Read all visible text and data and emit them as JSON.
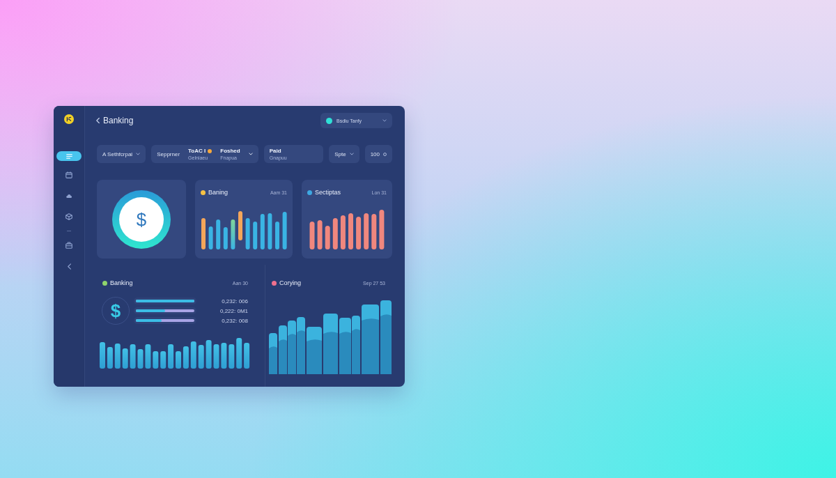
{
  "sidebar": {
    "items": [
      {
        "selected": true
      },
      {
        "selected": false
      },
      {
        "selected": false
      },
      {
        "selected": false
      },
      {
        "selected": false
      },
      {
        "selected": false
      }
    ]
  },
  "header": {
    "title": "Banking",
    "account_menu": {
      "label": "Bsdiu Tanfy"
    }
  },
  "filters": [
    {
      "kind": "dropdown",
      "label": "A Sethfcrpai"
    },
    {
      "kind": "group",
      "label": "Sepprner",
      "fields": [
        {
          "value": "ToAC I",
          "caption": "Gelniaeu",
          "color": "#f5a83c"
        },
        {
          "value": "Foshed",
          "caption": "Fnapua"
        }
      ]
    },
    {
      "kind": "field",
      "value": "Paid",
      "caption": "Gnapuu"
    },
    {
      "kind": "dropdown",
      "label": "Spte"
    },
    {
      "kind": "counter",
      "label": "100"
    }
  ],
  "cards": [
    {
      "kind": "balance",
      "symbol": "$"
    },
    {
      "kind": "activity",
      "title": "Baning",
      "date": "Aam 31",
      "color": "#f6c244"
    },
    {
      "kind": "expenses",
      "title": "Sectiptas",
      "date": "Lon 31",
      "color": "#3ea8e2"
    }
  ],
  "panels": [
    {
      "kind": "breakdown",
      "title": "Banking",
      "date": "Aan 30",
      "color": "#8fd46c",
      "symbol": "$",
      "rows": [
        {
          "level": 1,
          "reading": "0,232: 006"
        },
        {
          "level": 0.5,
          "reading": "0,222: 0M1"
        },
        {
          "level": 0.44,
          "reading": "0,232: 008"
        }
      ]
    },
    {
      "kind": "trend",
      "title": "Corying",
      "date": "Sep 27 53",
      "color": "#f0708e"
    }
  ]
}
